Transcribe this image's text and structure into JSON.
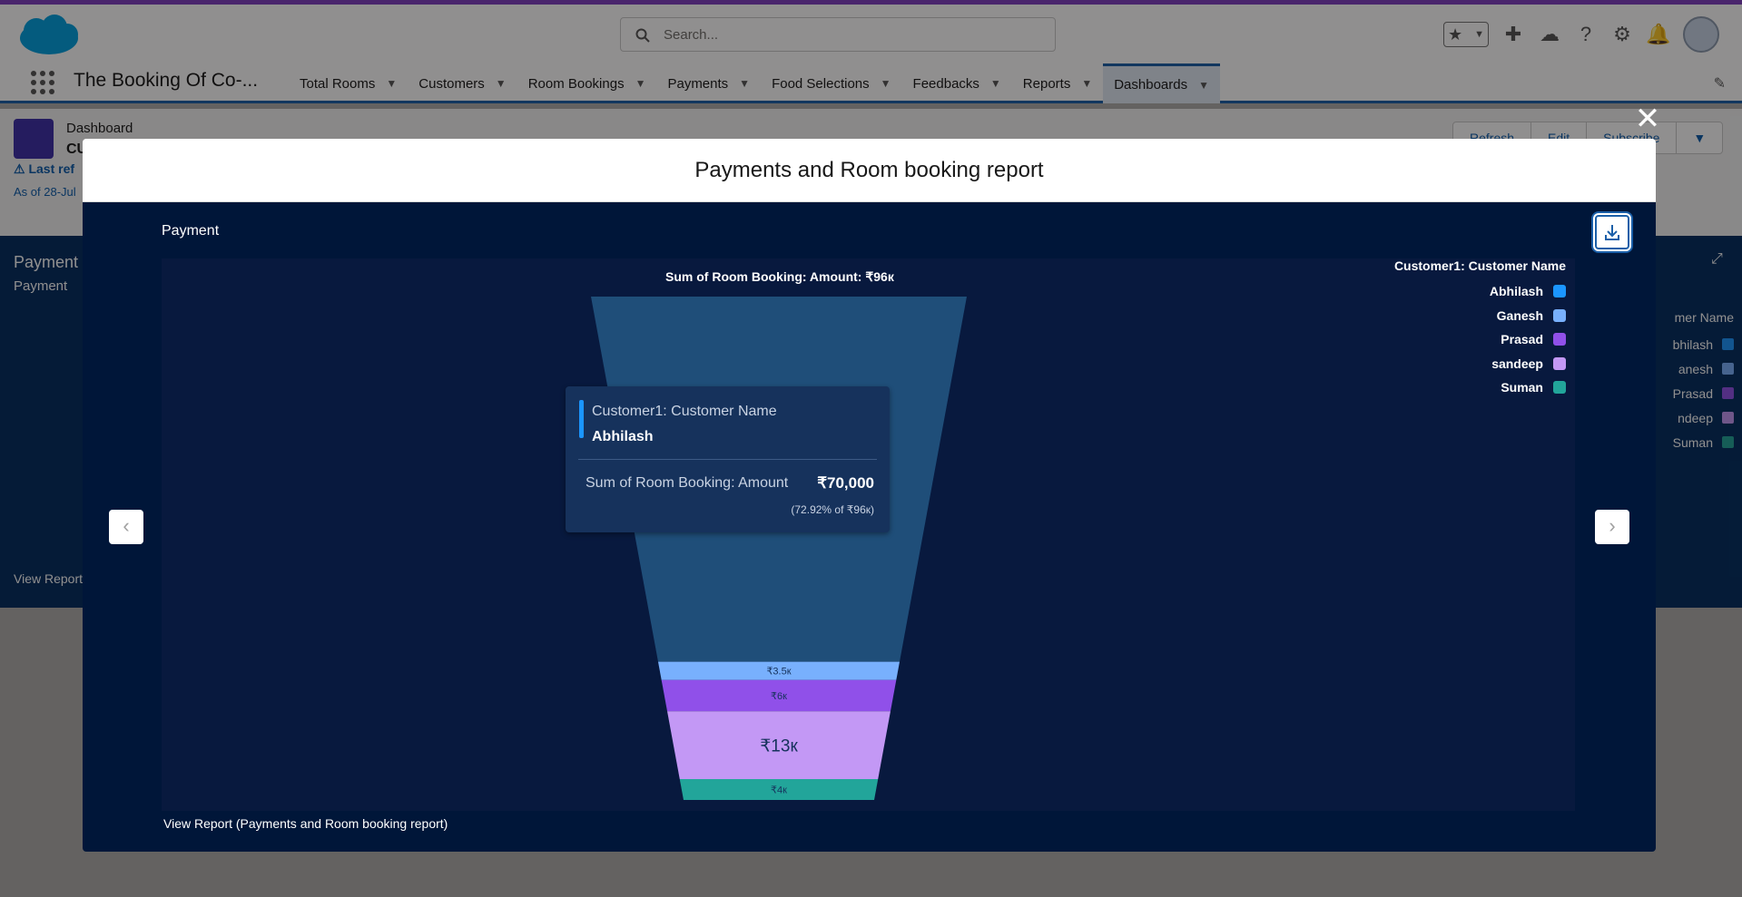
{
  "header": {
    "search_placeholder": "Search...",
    "app_name": "The Booking Of Co-..."
  },
  "nav": {
    "items": [
      {
        "label": "Total Rooms"
      },
      {
        "label": "Customers"
      },
      {
        "label": "Room Bookings"
      },
      {
        "label": "Payments"
      },
      {
        "label": "Food Selections"
      },
      {
        "label": "Feedbacks"
      },
      {
        "label": "Reports"
      },
      {
        "label": "Dashboards",
        "active": true
      }
    ]
  },
  "page": {
    "object_label": "Dashboard",
    "dashboard_name": "CU",
    "last_refreshed": "Last ref",
    "as_of": "As of 28-Jul",
    "buttons": [
      "Refresh",
      "Edit",
      "Subscribe"
    ]
  },
  "background_component": {
    "title": "Payment",
    "subtitle": "Payment",
    "view_report": "View Report",
    "legend_title": "mer Name",
    "legend_items": [
      "bhilash",
      "anesh",
      "Prasad",
      "ndeep",
      "Suman"
    ]
  },
  "modal": {
    "title": "Payments and Room booking report",
    "component_title": "Payment",
    "view_report": "View Report (Payments and Room booking report)"
  },
  "colors": {
    "brand_purple": "#7f3fbf",
    "modal_bg": "#001639",
    "chart_bg": "#08193e",
    "accent_blue": "#1b5fa8"
  },
  "icons": {
    "close": "close-icon",
    "download": "download-icon",
    "prev": "chevron-left-icon",
    "next": "chevron-right-icon"
  },
  "chart_data": {
    "type": "funnel",
    "title": "Sum of Room Booking: Amount: ₹96к",
    "legend_title": "Customer1: Customer Name",
    "legend_position": "top-right",
    "categories": [
      "Abhilash",
      "Ganesh",
      "Prasad",
      "sandeep",
      "Suman"
    ],
    "values": [
      70000,
      3500,
      6000,
      13000,
      4000
    ],
    "labels": [
      "",
      "₹3.5к",
      "₹6к",
      "₹13к",
      "₹4к"
    ],
    "colors": [
      "#1f4e79",
      "#78b0fd",
      "#9050e9",
      "#c398f5",
      "#22a59a"
    ],
    "legend_colors": [
      "#1b96ff",
      "#78b0fd",
      "#9050e9",
      "#c398f5",
      "#22a59a"
    ],
    "tooltip": {
      "dimension_label": "Customer1: Customer Name",
      "dimension_value": "Abhilash",
      "measure_label": "Sum of Room Booking: Amount",
      "measure_value": "₹70,000",
      "percent_text": "(72.92% of ₹96к)"
    }
  }
}
